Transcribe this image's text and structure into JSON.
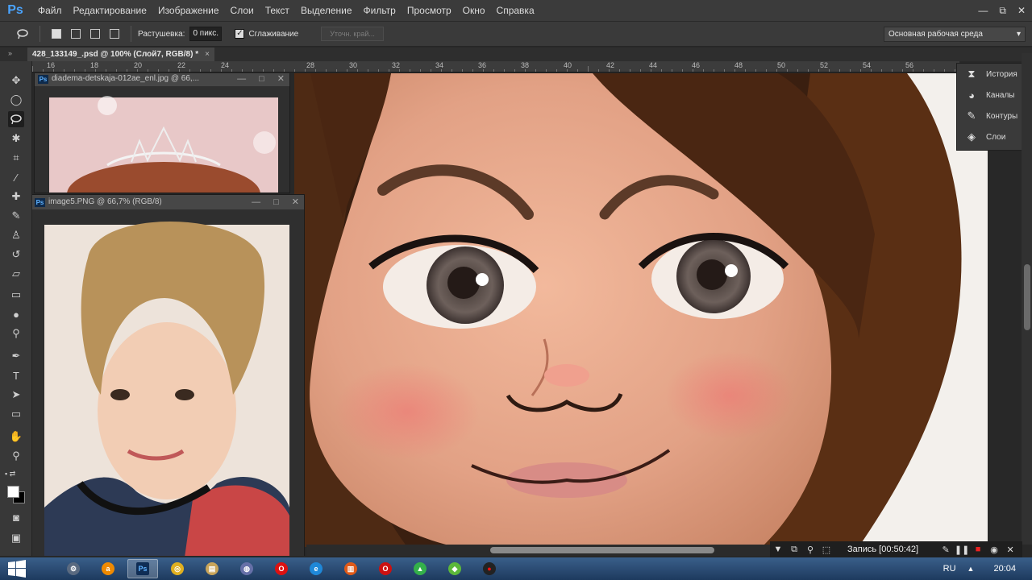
{
  "app": {
    "logo": "Ps"
  },
  "menu": [
    "Файл",
    "Редактирование",
    "Изображение",
    "Слои",
    "Текст",
    "Выделение",
    "Фильтр",
    "Просмотр",
    "Окно",
    "Справка"
  ],
  "window_controls": {
    "minimize": "—",
    "restore": "⧉",
    "close": "✕"
  },
  "options": {
    "feather_label": "Растушевка:",
    "feather_value": "0 пикс.",
    "antialias_label": "Сглаживание",
    "antialias_checked": true,
    "refine_label": "Уточн. край...",
    "workspace": "Основная рабочая среда"
  },
  "document_tab": {
    "title": "428_133149_.psd @ 100% (Слой7, RGB/8) *",
    "close": "×"
  },
  "ruler": {
    "labels": [
      "16",
      "18",
      "20",
      "22",
      "24",
      "28",
      "30",
      "32",
      "34",
      "36",
      "38",
      "40",
      "42",
      "44",
      "46",
      "48",
      "50",
      "52",
      "54",
      "56"
    ]
  },
  "floating_windows": [
    {
      "title": "diadema-detskaja-012ae_enl.jpg @ 66,...",
      "minimize": "—",
      "maximize": "□",
      "close": "✕"
    },
    {
      "title": "image5.PNG @ 66,7% (RGB/8)",
      "minimize": "—",
      "maximize": "□",
      "close": "✕"
    }
  ],
  "panels": [
    {
      "label": "История",
      "icon": "history-icon"
    },
    {
      "label": "Каналы",
      "icon": "channels-icon"
    },
    {
      "label": "Контуры",
      "icon": "paths-icon"
    },
    {
      "label": "Слои",
      "icon": "layers-icon"
    }
  ],
  "recorder": {
    "label": "Запись [00:50:42]"
  },
  "taskbar": {
    "apps": [
      "system-icon",
      "avast-icon",
      "photoshop-icon",
      "chrome-icon",
      "explorer-icon",
      "settings-icon",
      "opera-red-icon",
      "ie-icon",
      "office-icon",
      "opera-icon",
      "green-app-icon",
      "green-app2-icon",
      "record-icon"
    ],
    "active_app": "photoshop-icon",
    "lang": "RU",
    "tray_arrow": "▲",
    "clock": "20:04"
  },
  "colors": {
    "menu_bg": "#3b3b3b",
    "panel_bg": "#383838",
    "taskbar": "#2a4d78",
    "accent": "#4aa4ff"
  }
}
